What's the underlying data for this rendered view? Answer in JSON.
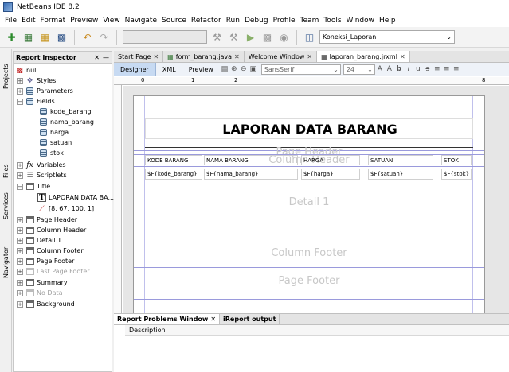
{
  "window": {
    "title": "NetBeans IDE 8.2"
  },
  "menu": [
    "File",
    "Edit",
    "Format",
    "Preview",
    "View",
    "Navigate",
    "Source",
    "Refactor",
    "Run",
    "Debug",
    "Profile",
    "Team",
    "Tools",
    "Window",
    "Help"
  ],
  "toolbar": {
    "connection": "Koneksi_Laporan"
  },
  "rail": {
    "projects": "Projects",
    "files": "Files",
    "services": "Services",
    "navigator": "Navigator"
  },
  "inspector": {
    "title": "Report Inspector",
    "root": "null",
    "styles": "Styles",
    "parameters": "Parameters",
    "fields_label": "Fields",
    "fields": [
      "kode_barang",
      "nama_barang",
      "harga",
      "satuan",
      "stok"
    ],
    "variables": "Variables",
    "scriptlets": "Scriptlets",
    "title_band": "Title",
    "title_text": "LAPORAN DATA BA...",
    "title_line": "[8, 67, 100, 1]",
    "page_header": "Page Header",
    "column_header": "Column Header",
    "detail": "Detail 1",
    "column_footer": "Column Footer",
    "page_footer": "Page Footer",
    "last_page_footer": "Last Page Footer",
    "summary": "Summary",
    "no_data": "No Data",
    "background": "Background"
  },
  "tabs": [
    {
      "label": "Start Page"
    },
    {
      "label": "form_barang.java"
    },
    {
      "label": "Welcome Window"
    },
    {
      "label": "laporan_barang.jrxml"
    }
  ],
  "designer": {
    "designer": "Designer",
    "xml": "XML",
    "preview": "Preview",
    "font": "SansSerif",
    "size": "24"
  },
  "ruler": {
    "t0": "0",
    "t1": "1",
    "t2": "2",
    "t8": "8"
  },
  "report": {
    "title": "LAPORAN DATA BARANG",
    "headers": [
      "KODE BARANG",
      "NAMA BARANG",
      "HARGA",
      "SATUAN",
      "STOK"
    ],
    "fields": [
      "$F{kode_barang}",
      "$F{nama_barang}",
      "$F{harga}",
      "$F{satuan}",
      "$F{stok}"
    ],
    "page_header_ghost": "Page Header",
    "column_header_ghost": "Column Header",
    "detail_ghost": "Detail 1",
    "column_footer_ghost": "Column Footer",
    "page_footer_ghost": "Page Footer"
  },
  "bottom": {
    "problems_tab": "Report Problems Window",
    "output_tab": "iReport output",
    "col_description": "Description"
  },
  "colors": {
    "accent": "#c7daf2",
    "band_line": "#9a9adc"
  }
}
